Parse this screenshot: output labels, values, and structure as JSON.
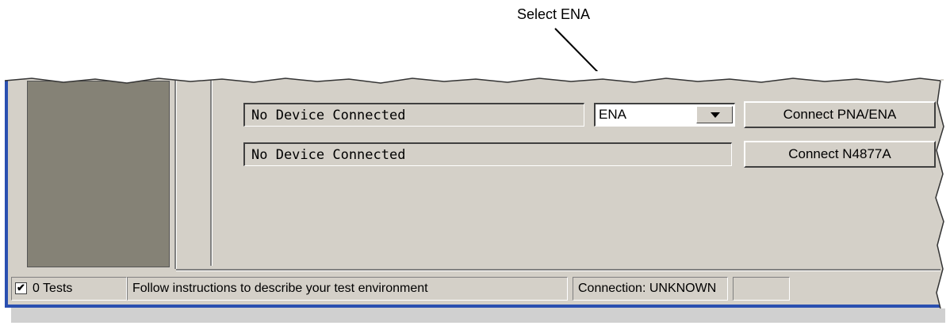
{
  "annotation": {
    "label": "Select ENA"
  },
  "panel": {
    "pna_field": {
      "value": "No Device Connected"
    },
    "n4877_field": {
      "value": "No Device Connected"
    },
    "device_select": {
      "selected": "ENA"
    },
    "connect_pna_button": {
      "label": "Connect PNA/ENA"
    },
    "connect_n4877_button": {
      "label": "Connect N4877A"
    }
  },
  "status_bar": {
    "tests_checked": true,
    "tests_label": "0 Tests",
    "message": "Follow instructions to describe your test environment",
    "connection": "Connection: UNKNOWN",
    "extra": ""
  },
  "icons": {
    "checkbox_mark": "✔",
    "dropdown": "chevron-down-icon"
  },
  "colors": {
    "window_bg": "#d4d0c8",
    "frame_blue": "#2a4fb0",
    "dark_panel": "#858276"
  }
}
